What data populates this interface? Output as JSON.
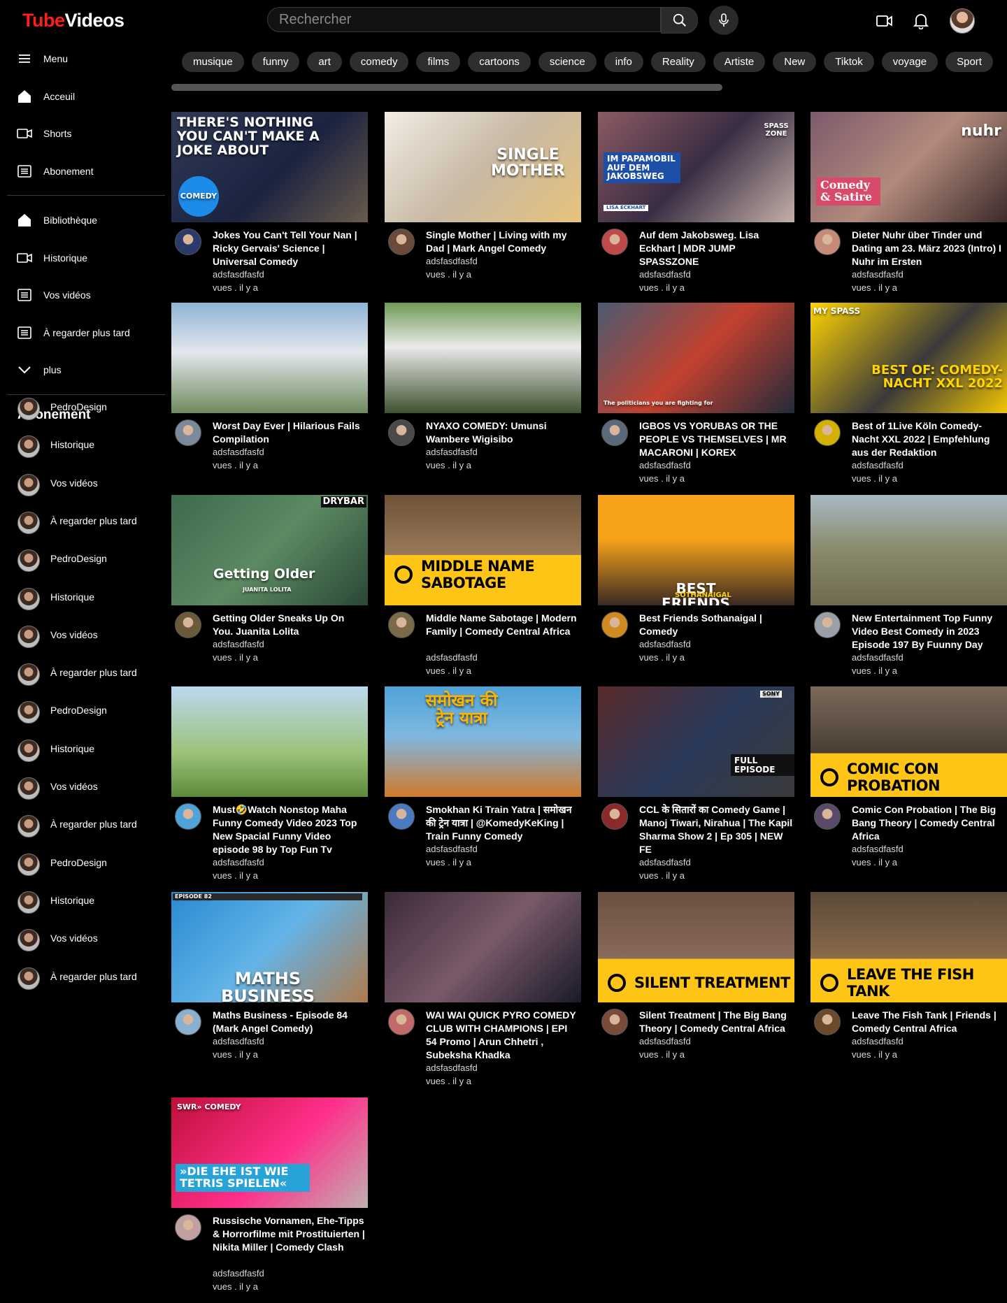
{
  "header": {
    "logo_part1": "Tube",
    "logo_part2": "Videos",
    "search_placeholder": "Rechercher",
    "icons": [
      "search-icon",
      "mic-icon",
      "create-video-icon",
      "bell-icon",
      "avatar"
    ]
  },
  "sidebar": {
    "menu_label": "Menu",
    "primary": [
      {
        "label": "Acceuil",
        "icon": "home-icon"
      },
      {
        "label": "Shorts",
        "icon": "video-icon"
      },
      {
        "label": "Abonement",
        "icon": "list-icon"
      }
    ],
    "secondary": [
      {
        "label": "Bibliothèque",
        "icon": "home-icon"
      },
      {
        "label": "Historique",
        "icon": "video-icon"
      },
      {
        "label": "Vos vidéos",
        "icon": "list-icon"
      },
      {
        "label": "À regarder plus tard",
        "icon": "list-icon"
      },
      {
        "label": "plus",
        "icon": "chevron-down-icon"
      }
    ],
    "subs_heading": "Abonement",
    "subscriptions": [
      "PedroDesign",
      "Historique",
      "Vos vidéos",
      "À regarder plus tard",
      "PedroDesign",
      "Historique",
      "Vos vidéos",
      "À regarder plus tard",
      "PedroDesign",
      "Historique",
      "Vos vidéos",
      "À regarder plus tard",
      "PedroDesign",
      "Historique",
      "Vos vidéos",
      "À regarder plus tard"
    ]
  },
  "chips": [
    "musique",
    "funny",
    "art",
    "comedy",
    "films",
    "cartoons",
    "science",
    "info",
    "Reality",
    "Artiste",
    "New",
    "Tiktok",
    "voyage",
    "Sport"
  ],
  "videos": [
    {
      "title": "Jokes You Can't Tell Your Nan | Ricky Gervais' Science | Universal Comedy",
      "channel": "adsfasdfasfd",
      "stats": "vues . il y a",
      "overlay": "THERE'S NOTHING YOU CAN'T MAKE A JOKE ABOUT",
      "badge": "COMEDY"
    },
    {
      "title": "Single Mother | Living with my Dad | Mark Angel Comedy",
      "channel": "adsfasdfasfd",
      "stats": "vues . il y a",
      "overlay": "SINGLE MOTHER"
    },
    {
      "title": "Auf dem Jakobsweg. Lisa Eckhart | MDR JUMP SPASSZONE",
      "channel": "adsfasdfasfd",
      "stats": "vues . il y a",
      "overlay": "IM PAPAMOBIL AUF DEM JAKOBSWEG",
      "badge": "SPASS ZONE",
      "sub_badge": "LISA ECKHART"
    },
    {
      "title": "Dieter Nuhr über Tinder und Dating am 23. März 2023 (Intro) I Nuhr im Ersten",
      "channel": "adsfasdfasfd",
      "stats": "vues . il y a",
      "overlay": "Comedy & Satire",
      "badge": "nuhr"
    },
    {
      "title": "Worst Day Ever | Hilarious Fails Compilation",
      "channel": "adsfasdfasfd",
      "stats": "vues . il y a"
    },
    {
      "title": "NYAXO COMEDY: Umunsi Wambere Wigisibo",
      "channel": "adsfasdfasfd",
      "stats": "vues . il y a"
    },
    {
      "title": "IGBOS VS YORUBAS OR THE PEOPLE VS THEMSELVES | MR MACARONI | KOREX",
      "channel": "adsfasdfasfd",
      "stats": "vues . il y a",
      "overlay": "The politicians you are fighting for"
    },
    {
      "title": "Best of 1Live Köln Comedy-Nacht XXL 2022 | Empfehlung aus der Redaktion",
      "channel": "adsfasdfasfd",
      "stats": "vues . il y a",
      "overlay": "BEST OF: COMEDY-NACHT XXL 2022",
      "badge": "MY SPASS"
    },
    {
      "title": "Getting Older Sneaks Up On You. Juanita Lolita",
      "channel": "adsfasdfasfd",
      "stats": "vues . il y a",
      "overlay": "Getting Older",
      "badge": "DRYBAR",
      "sub_badge": "JUANITA LOLITA"
    },
    {
      "title": "Middle Name Sabotage | Modern Family | Comedy Central Africa",
      "channel": "adsfasdfasfd",
      "stats": "vues . il y a",
      "overlay": "MIDDLE NAME SABOTAGE"
    },
    {
      "title": "Best Friends Sothanaigal | Comedy",
      "channel": "adsfasdfasfd",
      "stats": "vues . il y a",
      "overlay": "BEST FRIENDS",
      "sub_badge": "SOTHANAIGAL"
    },
    {
      "title": "New Entertainment Top Funny Video Best Comedy in 2023 Episode 197 By Fuunny Day",
      "channel": "adsfasdfasfd",
      "stats": "vues . il y a"
    },
    {
      "title": "Must🤣Watch Nonstop Maha Funny Comedy Video 2023 Top New Spacial Funny Video episode 98 by Top Fun Tv",
      "channel": "adsfasdfasfd",
      "stats": "vues . il y a"
    },
    {
      "title": "Smokhan Ki Train Yatra | समोखन की ट्रेन यात्रा | @KomedyKeKing | Train Funny Comedy",
      "channel": "adsfasdfasfd",
      "stats": "vues . il y a",
      "overlay": "समोखन की ट्रेन यात्रा"
    },
    {
      "title": "CCL के सितारों का Comedy Game | Manoj Tiwari, Nirahua | The Kapil Sharma Show 2 | Ep 305 | NEW FE",
      "channel": "adsfasdfasfd",
      "stats": "vues . il y a",
      "overlay": "FULL EPISODE",
      "badge": "SONY"
    },
    {
      "title": "Comic Con Probation | The Big Bang Theory | Comedy Central Africa",
      "channel": "adsfasdfasfd",
      "stats": "vues . il y a",
      "overlay": "COMIC CON PROBATION"
    },
    {
      "title": "Maths Business - Episode 84 (Mark Angel Comedy)",
      "channel": "adsfasdfasfd",
      "stats": "vues . il y a",
      "overlay": "MATHS BUSINESS",
      "badge": "EPISODE 82"
    },
    {
      "title": "WAI WAI QUICK PYRO COMEDY CLUB WITH CHAMPIONS | EPI 54 Promo | Arun Chhetri , Subeksha Khadka",
      "channel": "adsfasdfasfd",
      "stats": "vues . il y a"
    },
    {
      "title": "Silent Treatment | The Big Bang Theory | Comedy Central Africa",
      "channel": "adsfasdfasfd",
      "stats": "vues . il y a",
      "overlay": "SILENT TREATMENT"
    },
    {
      "title": "Leave The Fish Tank | Friends | Comedy Central Africa",
      "channel": "adsfasdfasfd",
      "stats": "vues . il y a",
      "overlay": "LEAVE THE FISH TANK"
    },
    {
      "title": "Russische Vornamen, Ehe-Tipps & Horrorfilme mit Prostituierten | Nikita Miller | Comedy Clash",
      "channel": "adsfasdfasfd",
      "stats": "vues . il y a",
      "overlay": "»DIE EHE IST WIE TETRIS SPIELEN«",
      "badge": "SWR» COMEDY"
    }
  ]
}
